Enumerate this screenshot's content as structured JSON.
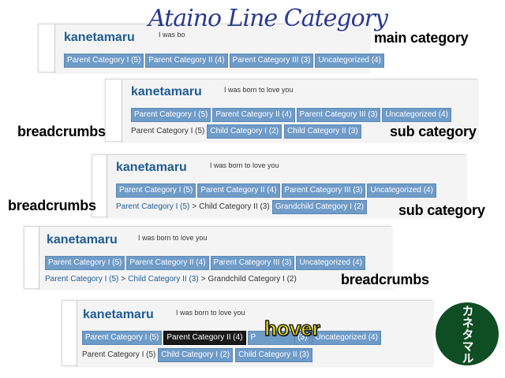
{
  "title": "Ataino Line Category",
  "site": {
    "logo": "kanetamaru",
    "tagline": "I was born to love you",
    "tagline_partial": "I was bo"
  },
  "labels": {
    "main_category": "main category",
    "breadcrumbs": "breadcrumbs",
    "sub_category": "sub category",
    "hover": "hover"
  },
  "main_tabs": [
    "Parent Category I (5)",
    "Parent Category II (4)",
    "Parent Category III (3)",
    "Uncategorized (4)"
  ],
  "main_tabs_overlap": [
    "P",
    "(3)"
  ],
  "child_sub_tabs": [
    "Child Category I (2)",
    "Child Category II (3)"
  ],
  "grandchild_sub_tabs": [
    "Grandchild Category I (2)"
  ],
  "breadcrumbs": {
    "parent": "Parent Category I (5)",
    "separator": ">",
    "child": "Child Category II (3)",
    "grandchild": "Grandchild Category I (2)"
  },
  "badge_text": "カネタマル",
  "colors": {
    "logo": "#1f5b93",
    "tab_bg": "#6f9bc8",
    "tab_hover_bg": "#1a1a1a",
    "badge_bg": "#0f4d23",
    "hover_label": "#f2e400"
  }
}
